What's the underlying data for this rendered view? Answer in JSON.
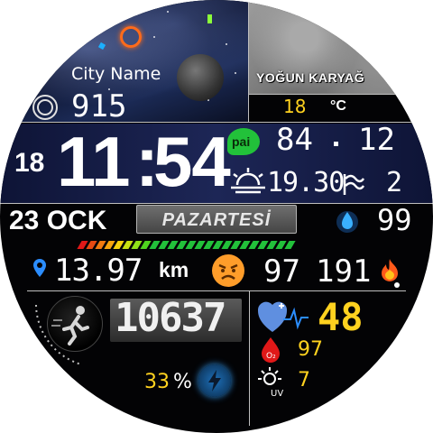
{
  "city": {
    "name": "City Name",
    "value": "915"
  },
  "weather": {
    "condition": "YOĞUN KARYAĞ",
    "temperature": "18",
    "unit": "°C"
  },
  "time": {
    "hour_small": "18",
    "hours": "11",
    "separator": ":",
    "minutes": "54"
  },
  "pai": {
    "badge": "pai",
    "value": "84",
    "seconds": "12"
  },
  "sunset": {
    "time": "19.30",
    "wind": "2"
  },
  "date": {
    "day_month": "23 OCK",
    "weekday": "PAZARTESİ"
  },
  "humidity": {
    "value": "99"
  },
  "distance": {
    "value": "13.97",
    "unit": "km"
  },
  "mood_icon": "angry-face-icon",
  "stats": {
    "stress": "97",
    "calories": "191"
  },
  "steps": {
    "value": "10637"
  },
  "battery": {
    "percent": "33",
    "percent_sign": "%"
  },
  "heart": {
    "value": "48"
  },
  "spo2": {
    "value": "97"
  },
  "uv": {
    "value": "7"
  },
  "colors": {
    "accent_yellow": "#ffd21f",
    "orange": "#ff9a1f",
    "red": "#e01818",
    "pai_green": "#22c13a",
    "blue": "#2b8dff"
  },
  "icons": [
    "sun-icon",
    "moon-icon",
    "pai-icon",
    "sunset-icon",
    "wind-icon",
    "water-drop-icon",
    "location-pin-icon",
    "angry-face-icon",
    "fire-icon",
    "runner-icon",
    "lightning-icon",
    "heart-icon",
    "spo2-icon",
    "uv-icon",
    "city-ring-icon"
  ]
}
